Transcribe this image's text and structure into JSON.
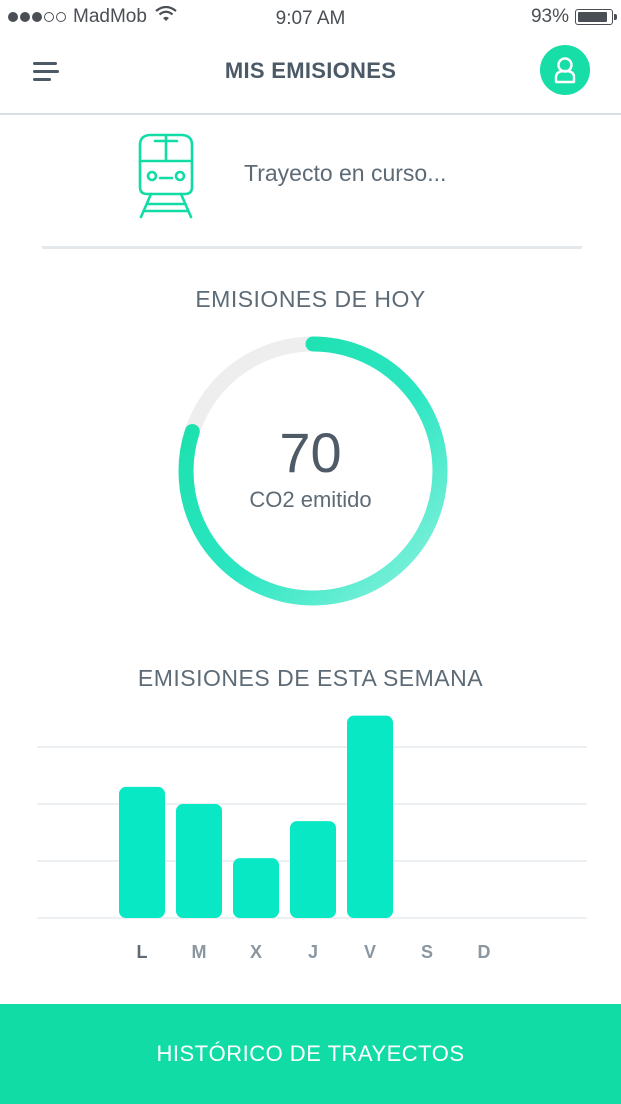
{
  "status_bar": {
    "carrier": "MadMob",
    "time": "9:07 AM",
    "battery": "93%",
    "battery_level": 0.93
  },
  "header": {
    "title": "MIS EMISIONES"
  },
  "trip": {
    "status": "Trayecto en curso..."
  },
  "today": {
    "title": "EMISIONES DE HOY",
    "value": "70",
    "label": "CO2 emitido",
    "progress": 0.8
  },
  "week": {
    "title": "EMISIONES DE ESTA SEMANA"
  },
  "chart_data": {
    "type": "bar",
    "categories": [
      "L",
      "M",
      "X",
      "J",
      "V",
      "S",
      "D"
    ],
    "values": [
      2.3,
      2.0,
      1.05,
      1.7,
      3.55,
      0,
      0
    ],
    "ylim": [
      0,
      3
    ],
    "gridlines": 3,
    "bar_color": "#08e8c4",
    "active_category": "L"
  },
  "footer": {
    "button_label": "HISTÓRICO DE TRAYECTOS"
  },
  "colors": {
    "accent": "#17dea6",
    "button": "#12dca6",
    "gauge_track": "#eeeeee"
  }
}
